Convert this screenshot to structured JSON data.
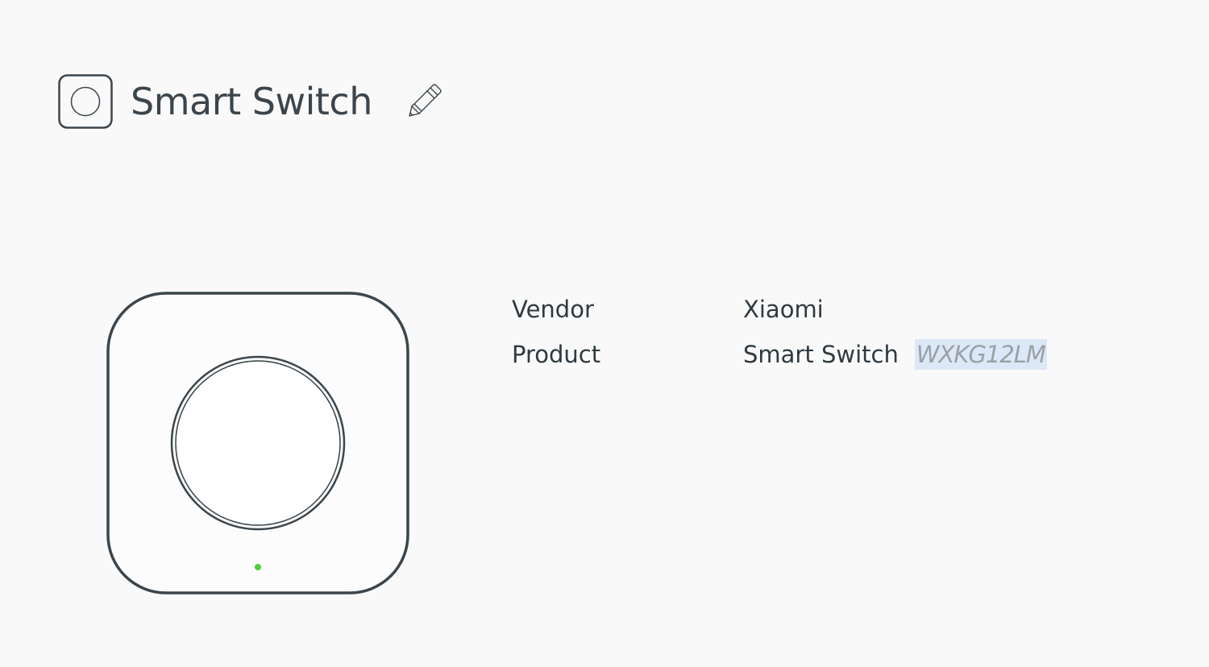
{
  "header": {
    "title": "Smart Switch",
    "device_icon": "switch-outline-icon",
    "edit_icon": "pencil-icon"
  },
  "device_image": {
    "icon": "wireless-switch-illustration",
    "led_color": "#4cd137",
    "outline_color": "#3b454b"
  },
  "info": {
    "rows": [
      {
        "label": "Vendor",
        "value": "Xiaomi"
      },
      {
        "label": "Product",
        "value": "Smart Switch",
        "model": "WXKG12LM"
      }
    ]
  },
  "colors": {
    "background": "#f9f9f9",
    "text": "#3b454b",
    "selection_highlight": "#dce8f7",
    "muted_text": "#9aa1a6"
  }
}
